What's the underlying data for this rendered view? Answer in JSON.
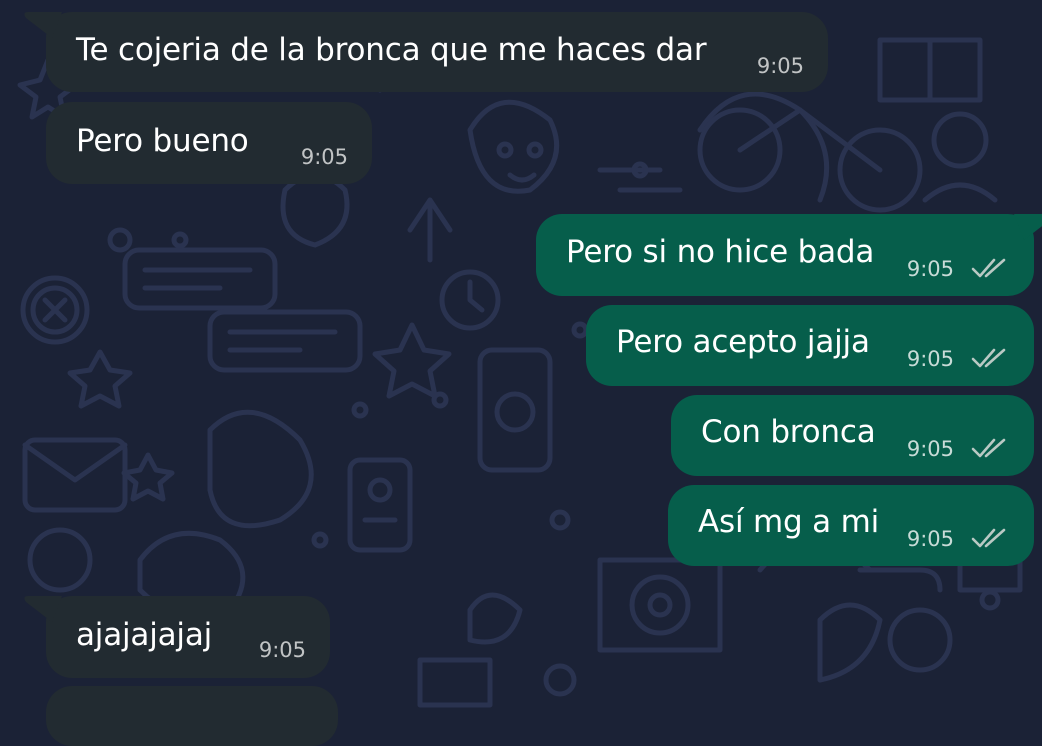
{
  "colors": {
    "background": "#1b2236",
    "incoming_bubble": "#222b31",
    "outgoing_bubble": "#065e4b",
    "read_ticks": "#b9c9c4"
  },
  "messages": [
    {
      "direction": "incoming",
      "text": "Te cojeria de la bronca que me haces dar",
      "time": "9:05"
    },
    {
      "direction": "incoming",
      "text": "Pero bueno",
      "time": "9:05"
    },
    {
      "direction": "outgoing",
      "text": "Pero si no hice bada",
      "time": "9:05",
      "status_icon": "double-check-icon"
    },
    {
      "direction": "outgoing",
      "text": "Pero acepto jajja",
      "time": "9:05",
      "status_icon": "double-check-icon"
    },
    {
      "direction": "outgoing",
      "text": "Con bronca",
      "time": "9:05",
      "status_icon": "double-check-icon"
    },
    {
      "direction": "outgoing",
      "text": "Así mg a mi",
      "time": "9:05",
      "status_icon": "double-check-icon"
    },
    {
      "direction": "incoming",
      "text": "ajajajajaj",
      "time": "9:05"
    }
  ]
}
